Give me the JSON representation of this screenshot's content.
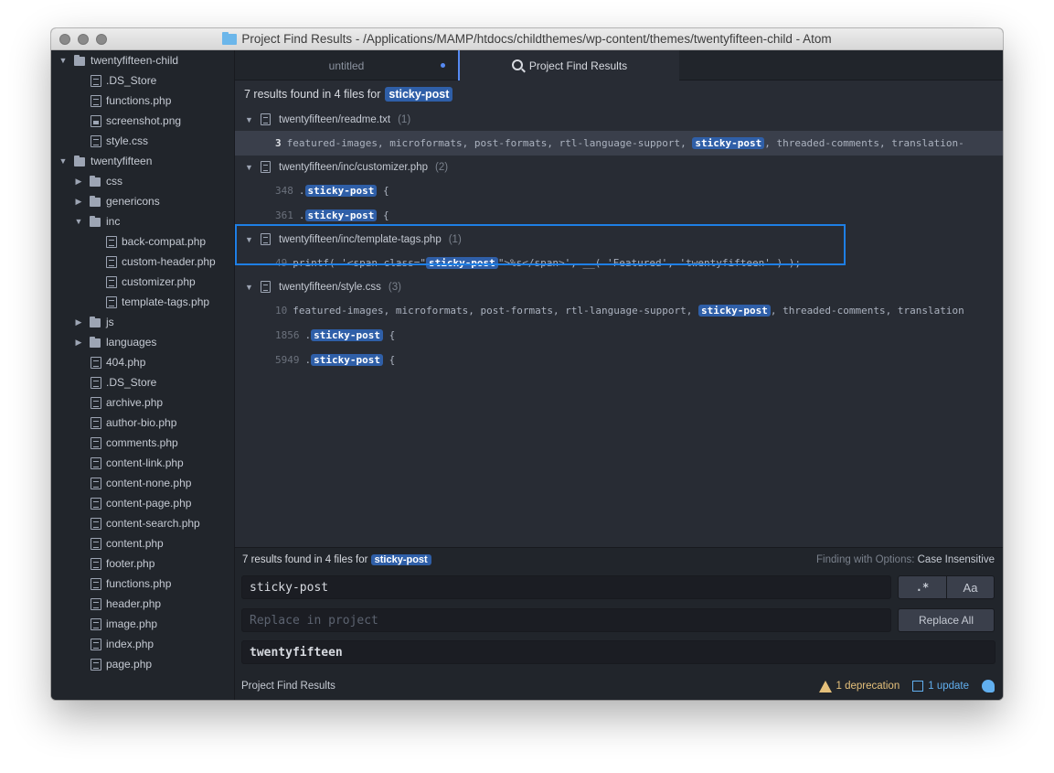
{
  "window": {
    "title": "Project Find Results - /Applications/MAMP/htdocs/childthemes/wp-content/themes/twentyfifteen-child - Atom"
  },
  "sidebar": {
    "items": [
      {
        "label": "twentyfifteen-child",
        "type": "dir",
        "expanded": true,
        "depth": 0
      },
      {
        "label": ".DS_Store",
        "type": "file",
        "depth": 1
      },
      {
        "label": "functions.php",
        "type": "file",
        "depth": 1
      },
      {
        "label": "screenshot.png",
        "type": "image",
        "depth": 1
      },
      {
        "label": "style.css",
        "type": "file",
        "depth": 1
      },
      {
        "label": "twentyfifteen",
        "type": "dir",
        "expanded": true,
        "depth": 0
      },
      {
        "label": "css",
        "type": "dir",
        "expanded": false,
        "depth": 1
      },
      {
        "label": "genericons",
        "type": "dir",
        "expanded": false,
        "depth": 1
      },
      {
        "label": "inc",
        "type": "dir",
        "expanded": true,
        "depth": 1
      },
      {
        "label": "back-compat.php",
        "type": "file",
        "depth": 2
      },
      {
        "label": "custom-header.php",
        "type": "file",
        "depth": 2
      },
      {
        "label": "customizer.php",
        "type": "file",
        "depth": 2
      },
      {
        "label": "template-tags.php",
        "type": "file",
        "depth": 2
      },
      {
        "label": "js",
        "type": "dir",
        "expanded": false,
        "depth": 1
      },
      {
        "label": "languages",
        "type": "dir",
        "expanded": false,
        "depth": 1
      },
      {
        "label": "404.php",
        "type": "file",
        "depth": 1
      },
      {
        "label": ".DS_Store",
        "type": "file",
        "depth": 1
      },
      {
        "label": "archive.php",
        "type": "file",
        "depth": 1
      },
      {
        "label": "author-bio.php",
        "type": "file",
        "depth": 1
      },
      {
        "label": "comments.php",
        "type": "file",
        "depth": 1
      },
      {
        "label": "content-link.php",
        "type": "file",
        "depth": 1
      },
      {
        "label": "content-none.php",
        "type": "file",
        "depth": 1
      },
      {
        "label": "content-page.php",
        "type": "file",
        "depth": 1
      },
      {
        "label": "content-search.php",
        "type": "file",
        "depth": 1
      },
      {
        "label": "content.php",
        "type": "file",
        "depth": 1
      },
      {
        "label": "footer.php",
        "type": "file",
        "depth": 1
      },
      {
        "label": "functions.php",
        "type": "file",
        "depth": 1
      },
      {
        "label": "header.php",
        "type": "file",
        "depth": 1
      },
      {
        "label": "image.php",
        "type": "file",
        "depth": 1
      },
      {
        "label": "index.php",
        "type": "file",
        "depth": 1
      },
      {
        "label": "page.php",
        "type": "file",
        "depth": 1
      }
    ]
  },
  "tabs": [
    {
      "label": "untitled",
      "modified": true
    },
    {
      "label": "Project Find Results",
      "active": true
    }
  ],
  "results": {
    "summary_prefix": "7 results found in 4 files for",
    "query": "sticky-post",
    "files": [
      {
        "path": "twentyfifteen/readme.txt",
        "count": "(1)",
        "matches": [
          {
            "line": "3",
            "before": "featured-images, microformats, post-formats, rtl-language-support, ",
            "match": "sticky-post",
            "after": ", threaded-comments, translation-",
            "selected": true
          }
        ]
      },
      {
        "path": "twentyfifteen/inc/customizer.php",
        "count": "(2)",
        "matches": [
          {
            "line": "348",
            "before": ".",
            "match": "sticky-post",
            "after": " {"
          },
          {
            "line": "361",
            "before": ".",
            "match": "sticky-post",
            "after": " {"
          }
        ]
      },
      {
        "path": "twentyfifteen/inc/template-tags.php",
        "count": "(1)",
        "matches": [
          {
            "line": "49",
            "before": "printf( '<span class=\"",
            "match": "sticky-post",
            "after": "\">%s</span>', __( 'Featured', 'twentyfifteen' ) );"
          }
        ]
      },
      {
        "path": "twentyfifteen/style.css",
        "count": "(3)",
        "matches": [
          {
            "line": "10",
            "before": "featured-images, microformats, post-formats, rtl-language-support, ",
            "match": "sticky-post",
            "after": ", threaded-comments, translation"
          },
          {
            "line": "1856",
            "before": ".",
            "match": "sticky-post",
            "after": " {"
          },
          {
            "line": "5949",
            "before": ".",
            "match": "sticky-post",
            "after": " {"
          }
        ]
      }
    ]
  },
  "find_panel": {
    "summary_prefix": "7 results found in 4 files for",
    "query": "sticky-post",
    "options_label": "Finding with Options:",
    "options_value": "Case Insensitive",
    "find_value": "sticky-post",
    "replace_placeholder": "Replace in project",
    "paths_value": "twentyfifteen",
    "regex_label": ".*",
    "case_label": "Aa",
    "replace_all_label": "Replace All"
  },
  "status_bar": {
    "left": "Project Find Results",
    "deprecation": "1 deprecation",
    "update": "1 update"
  },
  "colors": {
    "highlight": "#2f5fa8",
    "focus_border": "#1e7fe5",
    "warning": "#e5c07b",
    "info": "#61afef"
  }
}
